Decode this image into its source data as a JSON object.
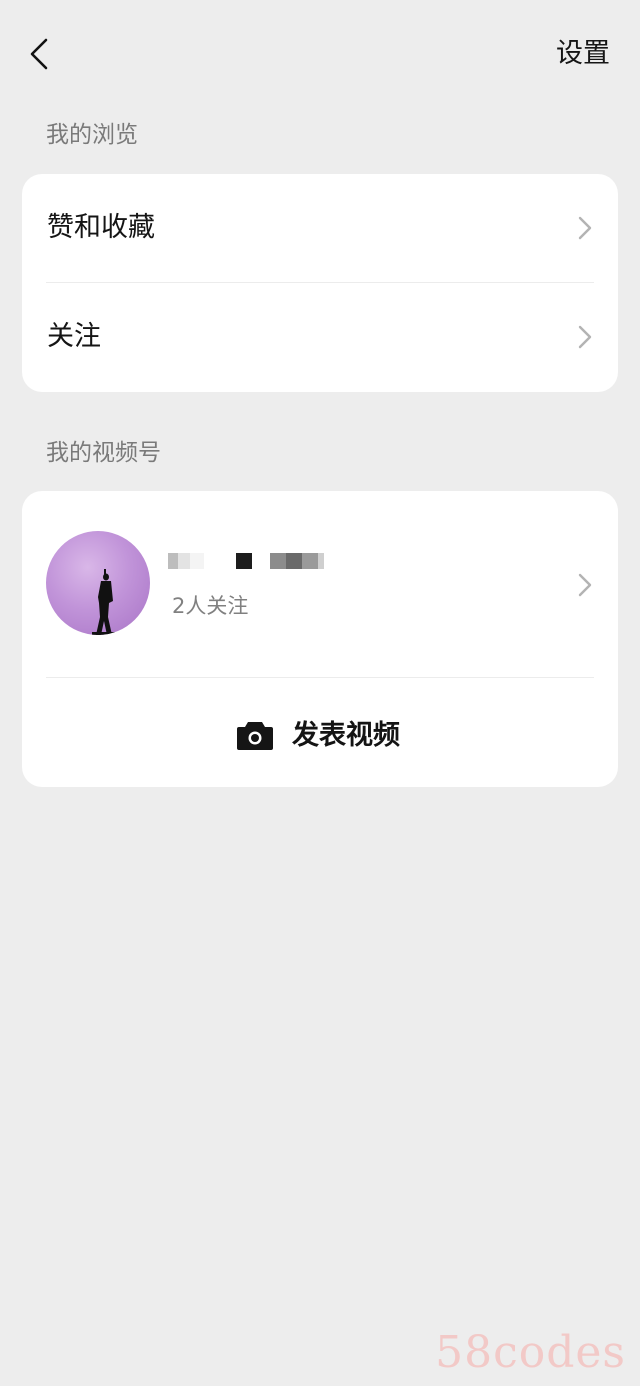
{
  "header": {
    "back_icon": "chevron-left-icon",
    "settings_label": "设置"
  },
  "browse_section": {
    "title": "我的浏览",
    "items": [
      {
        "label": "赞和收藏",
        "icon": "chevron-right-icon"
      },
      {
        "label": "关注",
        "icon": "chevron-right-icon"
      }
    ]
  },
  "channels_section": {
    "title": "我的视频号",
    "channel": {
      "followers_text": "2人关注",
      "avatar_icon": "avatar-silhouette-icon"
    },
    "post_video_label": "发表视频",
    "post_icon": "camera-icon"
  },
  "watermark": "58codes",
  "colors": {
    "background": "#ededed",
    "card": "#ffffff",
    "secondary_text": "#7a7a7a",
    "chevron": "#b3b3b3",
    "avatar": "#c194d9",
    "watermark": "#f2c9c7"
  }
}
